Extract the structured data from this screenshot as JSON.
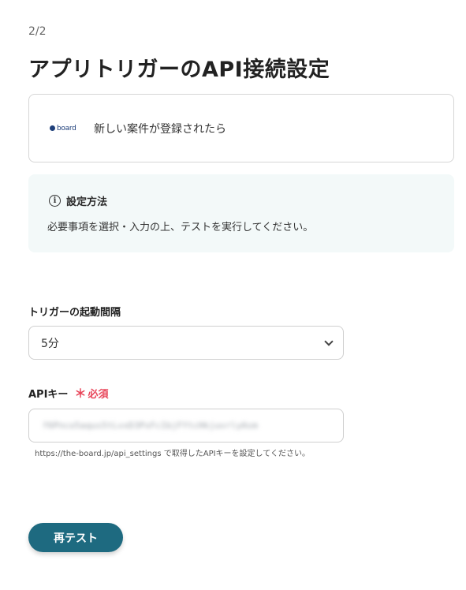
{
  "header": {
    "step": "2/2",
    "title": "アプリトリガーのAPI接続設定"
  },
  "app_card": {
    "logo_text": "board",
    "logo_icon": "board-logo-icon",
    "trigger_label": "新しい案件が登録されたら"
  },
  "info": {
    "icon": "info-icon",
    "title": "設定方法",
    "text": "必要事項を選択・入力の上、テストを実行してください。"
  },
  "form": {
    "interval_label": "トリガーの起動間隔",
    "interval_value": "5分",
    "api_key_label": "APIキー",
    "required_star": "＊",
    "required_text": "必須",
    "api_key_value": "f6Pnco5aqus5tLvxD3PxFcIbjFYtcHkjuvrlyAsm",
    "help_text": "https://the-board.jp/api_settings で取得したAPIキーを設定してください。"
  },
  "actions": {
    "retest_label": "再テスト"
  },
  "colors": {
    "accent": "#1e6a80",
    "required": "#e8465a",
    "info_bg": "#f3f9f9"
  }
}
